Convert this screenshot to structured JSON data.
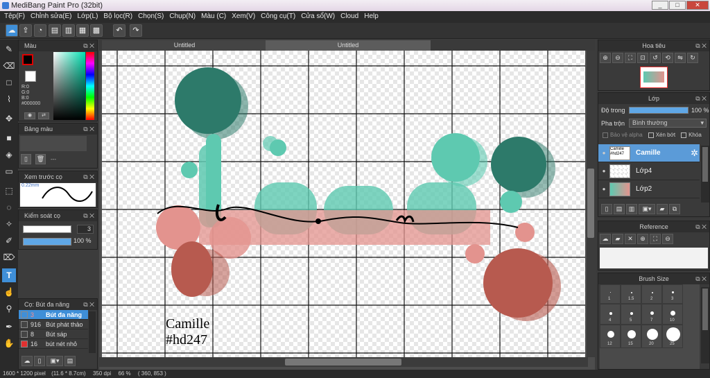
{
  "window": {
    "title": "MediBang Paint Pro (32bit)",
    "minimize": "_",
    "maximize": "□",
    "close": "✕"
  },
  "menu": [
    "Tệp(F)",
    "Chỉnh sửa(E)",
    "Lớp(L)",
    "Bộ lọc(R)",
    "Chọn(S)",
    "Chụp(N)",
    "Màu (C)",
    "Xem(V)",
    "Công cụ(T)",
    "Cửa sổ(W)",
    "Cloud",
    "Help"
  ],
  "toolbar_icons": [
    "cloud-icon",
    "share-icon",
    "comment-icon",
    "document-icon",
    "page-icon",
    "grid-page-icon",
    "pages-icon",
    "undo-icon",
    "redo-icon"
  ],
  "color_panel": {
    "title": "Màu",
    "r": "R:0",
    "g": "G:0",
    "b": "B:0",
    "hex": "#000000",
    "fg": "#000000",
    "bg": "#ffffff"
  },
  "palette_panel": {
    "title": "Bảng màu",
    "more": "---"
  },
  "preview_panel": {
    "title": "Xem trước cọ",
    "size": "0.22mm"
  },
  "brush_control": {
    "title": "Kiểm soát cọ",
    "size": "3",
    "opacity": "100 %",
    "opacity_fraction": 1.0
  },
  "brush_list": {
    "title": "Cọ: Bút đa năng",
    "items": [
      {
        "size": "3",
        "name": "Bút đa năng",
        "color": "#2a7fd4",
        "selected": true
      },
      {
        "size": "916",
        "name": "Bút phát thảo",
        "color": "#444444",
        "selected": false
      },
      {
        "size": "8",
        "name": "Bút sáp",
        "color": "#444444",
        "selected": false
      },
      {
        "size": "16",
        "name": "bút nét nhỏ",
        "color": "#e03030",
        "selected": false
      }
    ]
  },
  "tabs": [
    "Untitled",
    "Untitled"
  ],
  "canvas_text": {
    "line1": "Camille",
    "line2": "#hd247"
  },
  "navigator": {
    "title": "Hoa tiêu"
  },
  "layers": {
    "title": "Lớp",
    "opacity_label": "Độ trong",
    "opacity_value": "100 %",
    "opacity_fraction": 1.0,
    "blend_label": "Pha trộn",
    "blend_value": "Bình thường",
    "protect_alpha": "Bảo vệ alpha",
    "clip": "Xén bớt",
    "lock": "Khóa",
    "items": [
      {
        "name": "Camille",
        "thumb": "Camille #hd247",
        "selected": true
      },
      {
        "name": "Lớp4",
        "thumb": "",
        "selected": false
      },
      {
        "name": "Lớp2",
        "thumb": "",
        "selected": false
      }
    ]
  },
  "reference": {
    "title": "Reference"
  },
  "brush_size": {
    "title": "Brush Size",
    "sizes": [
      "1",
      "1.5",
      "2",
      "3",
      "4",
      "5",
      "7",
      "10",
      "12",
      "15",
      "20",
      "25"
    ]
  },
  "status": {
    "pixels": "1600 * 1200 pixel",
    "cm": "(11.6 * 8.7cm)",
    "dpi": "350 dpi",
    "zoom": "66 %",
    "coords": "( 360, 853 )"
  },
  "colors": {
    "teal_dark": "#2d7a6a",
    "teal": "#5ec9b0",
    "salmon": "#e3938e",
    "rust": "#b75a4f",
    "accent_blue": "#3f8fd8"
  }
}
